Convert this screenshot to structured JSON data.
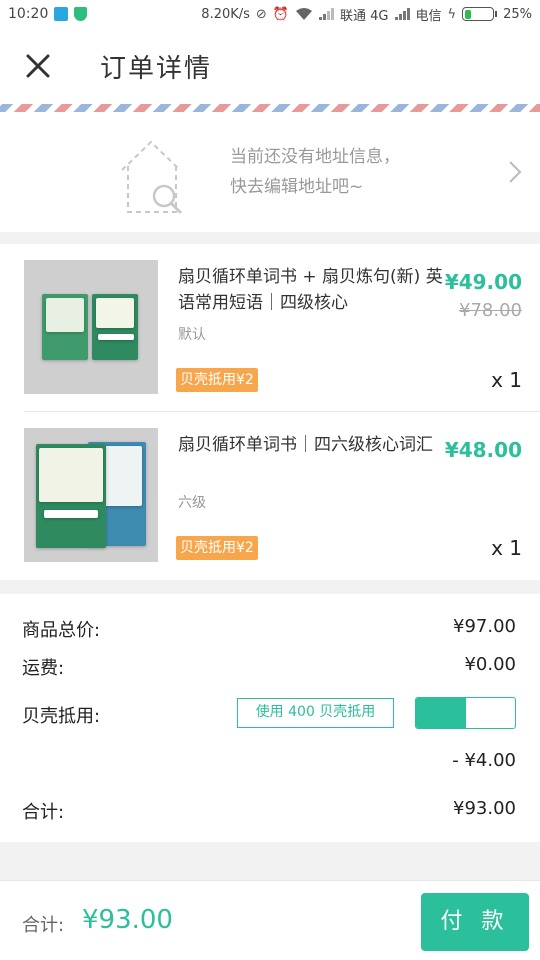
{
  "status_bar": {
    "time": "10:20",
    "network_speed": "8.20K/s",
    "carrier_1": "联通 4G",
    "carrier_2": "电信",
    "battery": "25%",
    "battery_level": 0.25
  },
  "header": {
    "title": "订单详情",
    "close_icon": "close-icon"
  },
  "address": {
    "line1": "当前还没有地址信息，",
    "line2": "快去编辑地址吧~",
    "icon": "house-search-icon"
  },
  "products": [
    {
      "name": "扇贝循环单词书 + 扇贝炼句(新) 英语常用短语｜四级核心",
      "spec": "默认",
      "tag": "贝壳抵用¥2",
      "price": "¥49.00",
      "original_price": "¥78.00",
      "quantity": "x 1"
    },
    {
      "name": "扇贝循环单词书｜四六级核心词汇",
      "spec": "六级",
      "tag": "贝壳抵用¥2",
      "price": "¥48.00",
      "quantity": "x 1"
    }
  ],
  "summary": {
    "subtotal_label": "商品总价:",
    "subtotal_value": "¥97.00",
    "shipping_label": "运费:",
    "shipping_value": "¥0.00",
    "shell_label": "贝壳抵用:",
    "shell_button": "使用 400 贝壳抵用",
    "shell_toggle_on": true,
    "shell_discount": "- ¥4.00",
    "total_label": "合计:",
    "total_value": "¥93.00"
  },
  "bottom_bar": {
    "total_label": "合计:",
    "total_value": "¥93.00",
    "pay_button": "付 款"
  },
  "colors": {
    "accent": "#2bbf9b",
    "tag": "#f7a64b"
  }
}
